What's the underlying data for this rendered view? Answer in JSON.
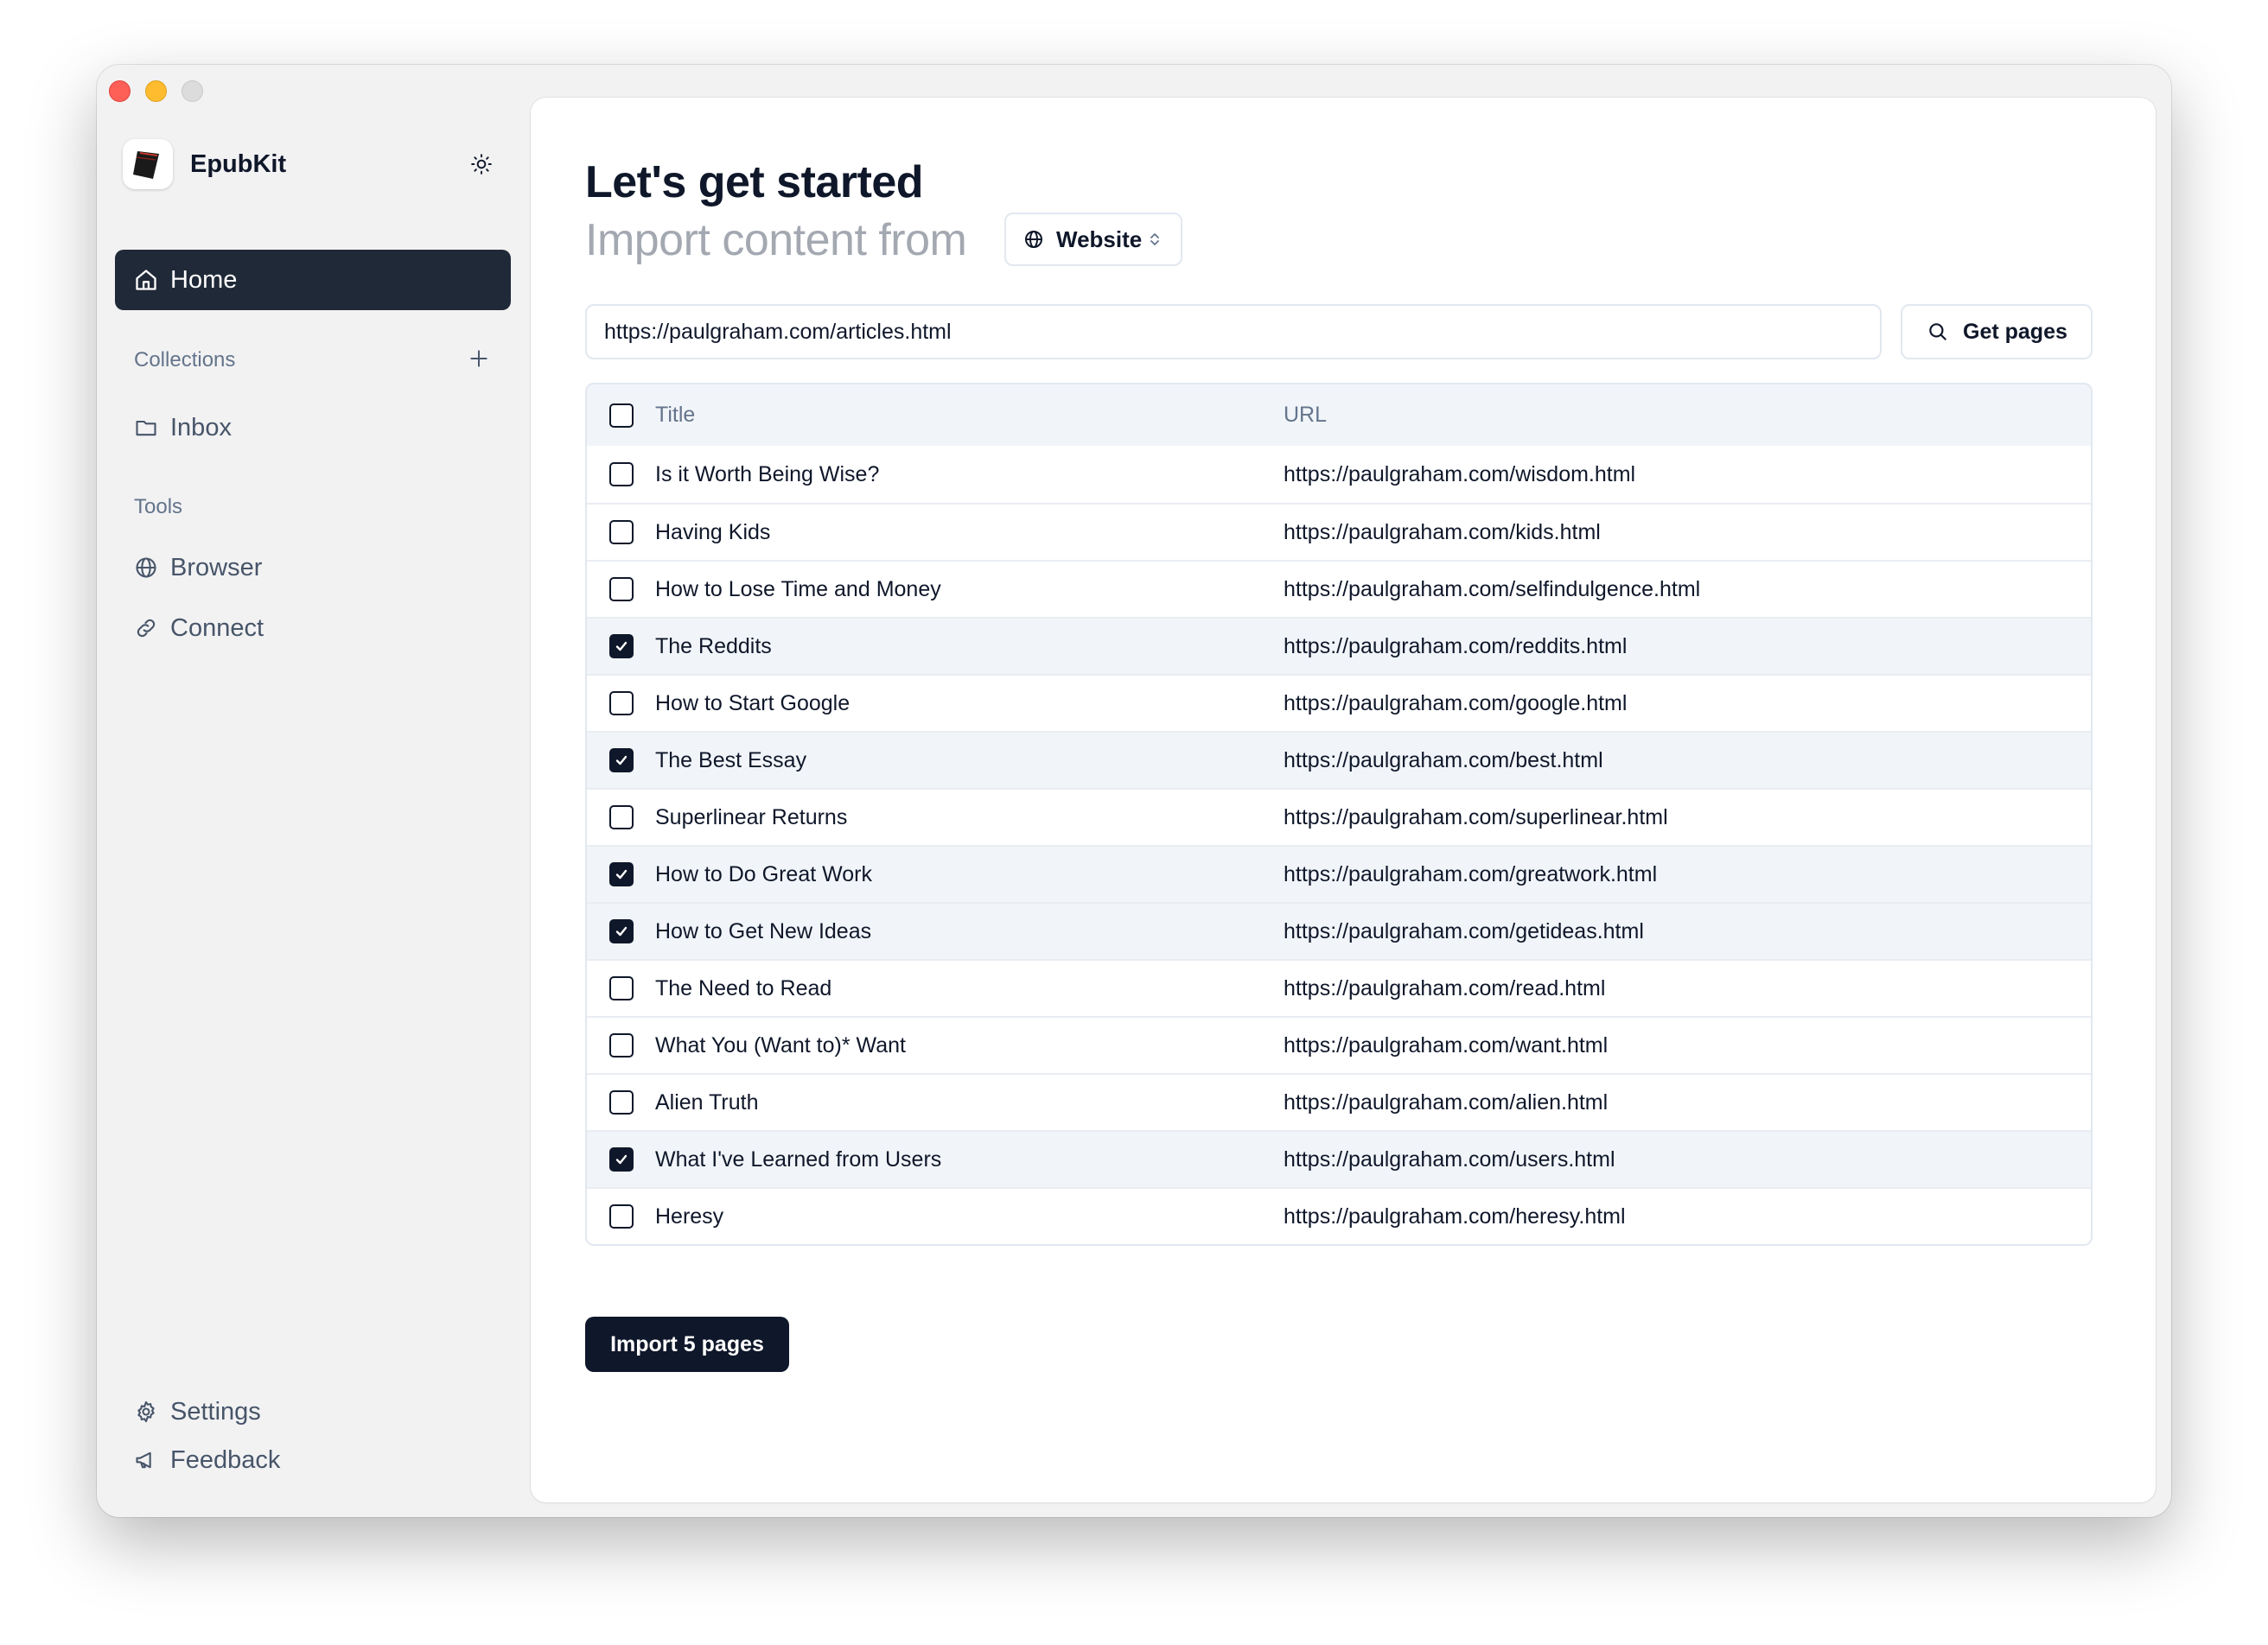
{
  "app": {
    "name": "EpubKit"
  },
  "sidebar": {
    "home_label": "Home",
    "collections_label": "Collections",
    "collections": [
      {
        "label": "Inbox",
        "icon": "folder-icon"
      }
    ],
    "tools_label": "Tools",
    "tools": [
      {
        "label": "Browser",
        "icon": "globe-icon"
      },
      {
        "label": "Connect",
        "icon": "link-icon"
      }
    ],
    "settings_label": "Settings",
    "feedback_label": "Feedback"
  },
  "main": {
    "title": "Let's get started",
    "subtitle": "Import content from",
    "source": {
      "label": "Website",
      "icon": "globe-icon"
    },
    "url_input": {
      "value": "https://paulgraham.com/articles.html"
    },
    "get_pages_label": "Get pages",
    "table": {
      "headers": {
        "title": "Title",
        "url": "URL"
      },
      "rows": [
        {
          "title": "Is it Worth Being Wise?",
          "url": "https://paulgraham.com/wisdom.html",
          "checked": false
        },
        {
          "title": "Having Kids",
          "url": "https://paulgraham.com/kids.html",
          "checked": false
        },
        {
          "title": "How to Lose Time and Money",
          "url": "https://paulgraham.com/selfindulgence.html",
          "checked": false
        },
        {
          "title": "The Reddits",
          "url": "https://paulgraham.com/reddits.html",
          "checked": true
        },
        {
          "title": "How to Start Google",
          "url": "https://paulgraham.com/google.html",
          "checked": false
        },
        {
          "title": "The Best Essay",
          "url": "https://paulgraham.com/best.html",
          "checked": true
        },
        {
          "title": "Superlinear Returns",
          "url": "https://paulgraham.com/superlinear.html",
          "checked": false
        },
        {
          "title": "How to Do Great Work",
          "url": "https://paulgraham.com/greatwork.html",
          "checked": true
        },
        {
          "title": "How to Get New Ideas",
          "url": "https://paulgraham.com/getideas.html",
          "checked": true
        },
        {
          "title": "The Need to Read",
          "url": "https://paulgraham.com/read.html",
          "checked": false
        },
        {
          "title": "What You (Want to)* Want",
          "url": "https://paulgraham.com/want.html",
          "checked": false
        },
        {
          "title": "Alien Truth",
          "url": "https://paulgraham.com/alien.html",
          "checked": false
        },
        {
          "title": "What I've Learned from Users",
          "url": "https://paulgraham.com/users.html",
          "checked": true
        },
        {
          "title": "Heresy",
          "url": "https://paulgraham.com/heresy.html",
          "checked": false
        }
      ]
    },
    "import_label": "Import 5 pages"
  },
  "colors": {
    "primary": "#0f172a",
    "selected_row": "#f1f5f9",
    "muted_text": "#64748b",
    "sidebar_bg": "#f2f2f3"
  }
}
